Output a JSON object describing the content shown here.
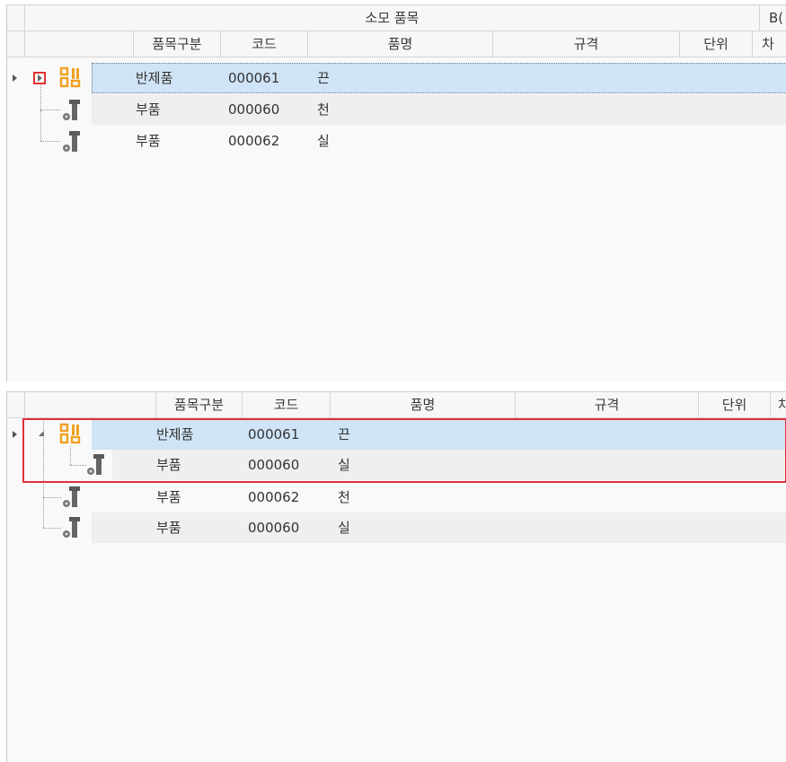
{
  "top_grid": {
    "group_headers": {
      "consumed_items": "소모 품목",
      "bom_partial": "B("
    },
    "columns": {
      "item_type": "품목구분",
      "code": "코드",
      "name": "품명",
      "spec": "규격",
      "unit": "단위",
      "partial": "차"
    },
    "rows": [
      {
        "type": "반제품",
        "code": "000061",
        "name": "끈"
      },
      {
        "type": "부품",
        "code": "000060",
        "name": "천"
      },
      {
        "type": "부품",
        "code": "000062",
        "name": "실"
      }
    ]
  },
  "bottom_grid": {
    "columns": {
      "item_type": "품목구분",
      "code": "코드",
      "name": "품명",
      "spec": "규격",
      "unit": "단위",
      "partial": "차"
    },
    "rows": [
      {
        "type": "반제품",
        "code": "000061",
        "name": "끈"
      },
      {
        "type": "부품",
        "code": "000060",
        "name": "실"
      },
      {
        "type": "부품",
        "code": "000062",
        "name": "천"
      },
      {
        "type": "부품",
        "code": "000060",
        "name": "실"
      }
    ]
  },
  "icons": {
    "assembly": "assembly-icon",
    "part": "bolt-part-icon"
  },
  "colors": {
    "selection": "#cfe4f6",
    "highlight_border": "#e0303a",
    "assembly_icon": "#f0a020",
    "part_icon": "#555555"
  }
}
